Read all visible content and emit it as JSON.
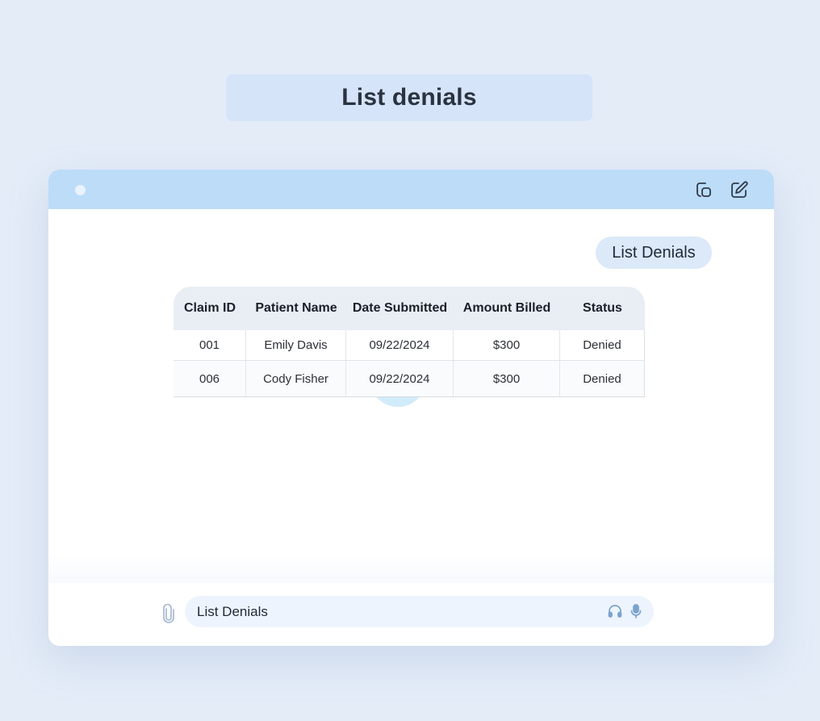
{
  "page": {
    "heading": "List denials"
  },
  "chat": {
    "user_message": "List Denials",
    "table": {
      "columns": [
        "Claim ID",
        "Patient Name",
        "Date Submitted",
        "Amount Billed",
        "Status"
      ],
      "rows": [
        [
          "001",
          "Emily Davis",
          "09/22/2024",
          "$300",
          "Denied"
        ],
        [
          "006",
          "Cody Fisher",
          "09/22/2024",
          "$300",
          "Denied"
        ]
      ]
    }
  },
  "composer": {
    "value": "List Denials"
  },
  "icons": {
    "window_dot": "dot",
    "new_window": "duplicate-window-icon",
    "edit": "edit-icon",
    "attach": "paperclip-icon",
    "headphones": "headphones-icon",
    "mic": "microphone-icon"
  },
  "colors": {
    "background": "#e4ecf8",
    "banner": "#d5e4f8",
    "topbar": "#bcdcf8",
    "bubble": "#dbe9f9",
    "input": "#eef4fd",
    "icon_accent": "#7aa3cf"
  }
}
